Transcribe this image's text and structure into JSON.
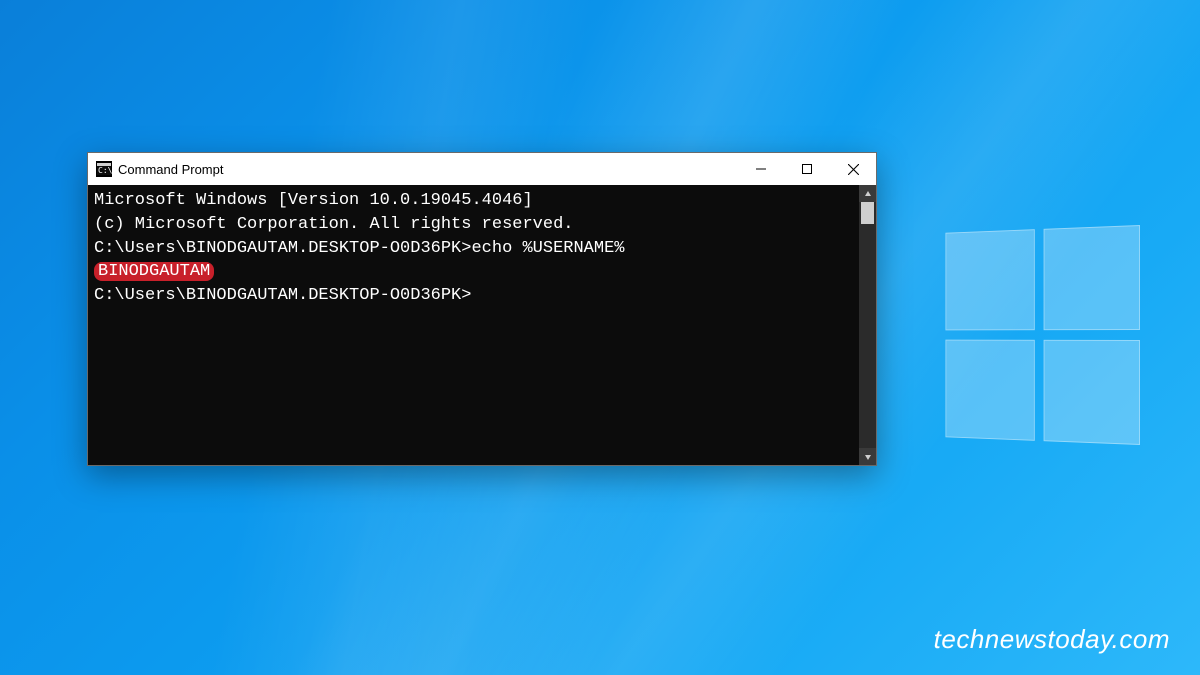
{
  "window": {
    "title": "Command Prompt"
  },
  "terminal": {
    "line1": "Microsoft Windows [Version 10.0.19045.4046]",
    "line2": "(c) Microsoft Corporation. All rights reserved.",
    "blank": "",
    "prompt1_path": "C:\\Users\\BINODGAUTAM.DESKTOP-O0D36PK>",
    "prompt1_command": "echo %USERNAME%",
    "output_username": "BINODGAUTAM",
    "prompt2_path": "C:\\Users\\BINODGAUTAM.DESKTOP-O0D36PK>"
  },
  "watermark": "technewstoday.com"
}
